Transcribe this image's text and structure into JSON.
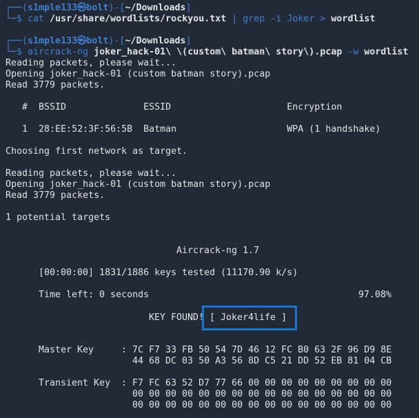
{
  "prompt1": {
    "top_prefix": "┌──(",
    "user_host": "s1mple133㉿bolt",
    "mid": ")-[",
    "path": "~/Downloads",
    "end": "]",
    "bottom_prefix": "└─$ ",
    "cmd": "cat",
    "arg1": " /usr/share/wordlists/rockyou.txt",
    "pipe": " | ",
    "cmd2": "grep",
    "opt": " -i",
    "arg2": " Joker",
    "redir": " > ",
    "arg3": "wordlist"
  },
  "prompt2": {
    "top_prefix": "┌──(",
    "user_host": "s1mple133㉿bolt",
    "mid": ")-[",
    "path": "~/Downloads",
    "end": "]",
    "bottom_prefix": "└─$ ",
    "cmd": "aircrack-ng",
    "arg1": " joker_hack-01\\ \\(custom\\ batman\\ story\\).pcap",
    "opt": " -w",
    "arg2": " wordlist"
  },
  "output": {
    "l1": "Reading packets, please wait...",
    "l2": "Opening joker_hack-01 (custom batman story).pcap",
    "l3": "Read 3779 packets.",
    "table_header": "   #  BSSID              ESSID                     Encryption",
    "table_row": "   1  28:EE:52:3F:56:5B  Batman                    WPA (1 handshake)",
    "l4": "Choosing first network as target.",
    "l5": "Reading packets, please wait...",
    "l6": "Opening joker_hack-01 (custom batman story).pcap",
    "l7": "Read 3779 packets.",
    "l8": "1 potential targets"
  },
  "aircrack": {
    "title": "Aircrack-ng 1.7",
    "keys_tested": "[00:00:00] 1831/1886 keys tested (11170.90 k/s)",
    "time_left": "Time left: 0 seconds",
    "percent": "97.08%",
    "key_found_label": "KEY FOUND!",
    "key_found_value": "[ Joker4life ]",
    "master_key_label": "Master Key     :",
    "master_key_1": "7C F7 33 FB 50 54 7D 46 12 FC B0 63 2F 96 D9 8E",
    "master_key_2": "44 68 DC 03 50 A3 56 8D C5 21 DD 52 EB 81 04 CB",
    "transient_key_label": "Transient Key  :",
    "transient_key_1": "F7 FC 63 52 D7 77 66 00 00 00 00 00 00 00 00 00",
    "transient_key_2": "00 00 00 00 00 00 00 00 00 00 00 00 00 00 00 00",
    "transient_key_3": "00 00 00 00 00 00 00 00 00 00 00 00 00 00 00 00"
  }
}
